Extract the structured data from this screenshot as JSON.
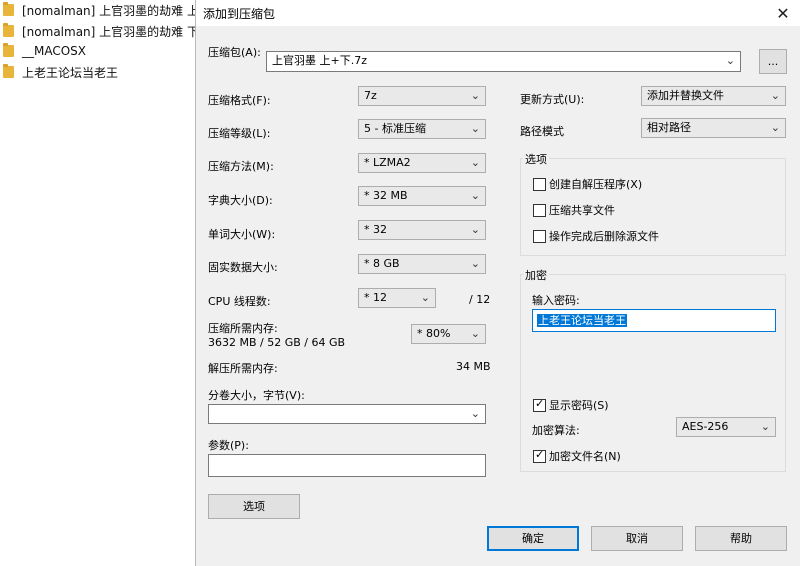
{
  "explorer": {
    "items": [
      {
        "label": "[nomalman] 上官羽墨的劫难 上"
      },
      {
        "label": "[nomalman] 上官羽墨的劫难 下"
      },
      {
        "label": "__MACOSX"
      },
      {
        "label": "上老王论坛当老王"
      }
    ]
  },
  "dialog": {
    "title": "添加到压缩包",
    "close_glyph": "✕",
    "archive_label": "压缩包(A):",
    "archive_value": "上官羽墨 上+下.7z",
    "browse_label": "...",
    "format_label": "压缩格式(F):",
    "format_value": "7z",
    "level_label": "压缩等级(L):",
    "level_value": "5 - 标准压缩",
    "method_label": "压缩方法(M):",
    "method_value": "* LZMA2",
    "dict_label": "字典大小(D):",
    "dict_value": "* 32 MB",
    "word_label": "单词大小(W):",
    "word_value": "* 32",
    "solid_label": "固实数据大小:",
    "solid_value": "* 8 GB",
    "cpu_label": "CPU 线程数:",
    "cpu_value": "* 12",
    "cpu_total": "/ 12",
    "mem_label": "压缩所需内存:",
    "mem_value": "3632 MB / 52 GB / 64 GB",
    "mem_percent": "* 80%",
    "decomp_label": "解压所需内存:",
    "decomp_value": "34 MB",
    "split_label": "分卷大小，字节(V):",
    "split_value": "",
    "params_label": "参数(P):",
    "params_value": "",
    "options_button": "选项",
    "update_label": "更新方式(U):",
    "update_value": "添加并替换文件",
    "path_label": "路径模式",
    "path_value": "相对路径",
    "options_group": "选项",
    "opt_sfx": "创建自解压程序(X)",
    "opt_shared": "压缩共享文件",
    "opt_delete": "操作完成后删除源文件",
    "encrypt_group": "加密",
    "password_label": "输入密码:",
    "password_value": "上老王论坛当老王",
    "show_password": "显示密码(S)",
    "enc_method_label": "加密算法:",
    "enc_method_value": "AES-256",
    "encrypt_names": "加密文件名(N)",
    "ok_button": "确定",
    "cancel_button": "取消",
    "help_button": "帮助",
    "arrow_glyph": "⌄"
  },
  "state": {
    "opt_sfx_checked": false,
    "opt_shared_checked": false,
    "opt_delete_checked": false,
    "show_password_checked": true,
    "encrypt_names_checked": true
  }
}
